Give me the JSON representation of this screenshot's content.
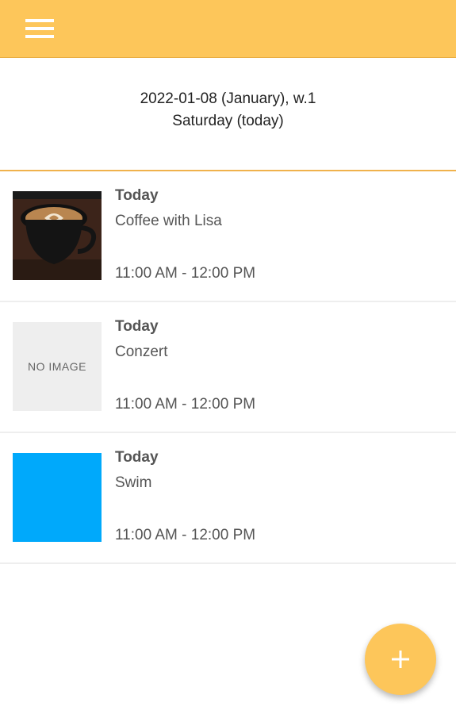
{
  "app": {
    "accent_color": "#fdc65a"
  },
  "toolbar": {
    "menu_icon": "hamburger-menu-icon"
  },
  "date_header": {
    "date_line": "2022-01-08 (January), w.1",
    "day_line": "Saturday (today)"
  },
  "events": [
    {
      "date_label": "Today",
      "title": "Coffee with Lisa",
      "time": "11:00 AM - 12:00 PM",
      "thumbnail": "coffee-cup-photo"
    },
    {
      "date_label": "Today",
      "title": "Conzert",
      "time": "11:00 AM - 12:00 PM",
      "thumbnail": "no-image-placeholder",
      "thumbnail_text": "NO IMAGE"
    },
    {
      "date_label": "Today",
      "title": "Swim",
      "time": "11:00 AM - 12:00 PM",
      "thumbnail": "color-swatch",
      "thumbnail_color": "#00a9fb"
    }
  ],
  "fab": {
    "icon": "plus-icon"
  }
}
